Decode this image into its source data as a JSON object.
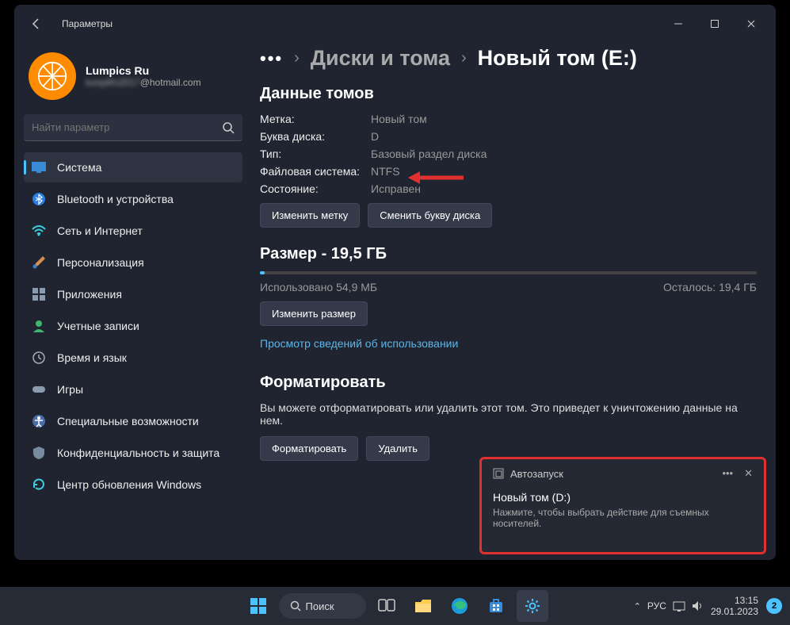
{
  "window": {
    "title": "Параметры",
    "user": {
      "name": "Lumpics Ru",
      "email_blur": "lumpifm2017",
      "email_domain": "@hotmail.com"
    },
    "search": {
      "placeholder": "Найти параметр"
    }
  },
  "nav": {
    "items": [
      {
        "label": "Система"
      },
      {
        "label": "Bluetooth и устройства"
      },
      {
        "label": "Сеть и Интернет"
      },
      {
        "label": "Персонализация"
      },
      {
        "label": "Приложения"
      },
      {
        "label": "Учетные записи"
      },
      {
        "label": "Время и язык"
      },
      {
        "label": "Игры"
      },
      {
        "label": "Специальные возможности"
      },
      {
        "label": "Конфиденциальность и защита"
      },
      {
        "label": "Центр обновления Windows"
      }
    ]
  },
  "breadcrumb": {
    "more": "•••",
    "disks": "Диски и тома",
    "current": "Новый том (E:)"
  },
  "volume": {
    "header": "Данные томов",
    "label_k": "Метка:",
    "label_v": "Новый том",
    "letter_k": "Буква диска:",
    "letter_v": "D",
    "type_k": "Тип:",
    "type_v": "Базовый раздел диска",
    "fs_k": "Файловая система:",
    "fs_v": "NTFS",
    "state_k": "Состояние:",
    "state_v": "Исправен",
    "btn_label": "Изменить метку",
    "btn_letter": "Сменить букву диска"
  },
  "size": {
    "header": "Размер - 19,5 ГБ",
    "used": "Использовано 54,9 МБ",
    "free": "Осталось: 19,4 ГБ",
    "btn_resize": "Изменить размер",
    "link_usage": "Просмотр сведений об использовании"
  },
  "format": {
    "header": "Форматировать",
    "text": "Вы можете отформатировать или удалить этот том. Это приведет к уничтожению данные на нем.",
    "btn_format": "Форматировать",
    "btn_delete": "Удалить"
  },
  "notification": {
    "app": "Автозапуск",
    "title": "Новый том (D:)",
    "body": "Нажмите, чтобы выбрать действие для съемных носителей."
  },
  "taskbar": {
    "search": "Поиск",
    "lang": "РУС",
    "time": "13:15",
    "date": "29.01.2023",
    "badge": "2"
  }
}
